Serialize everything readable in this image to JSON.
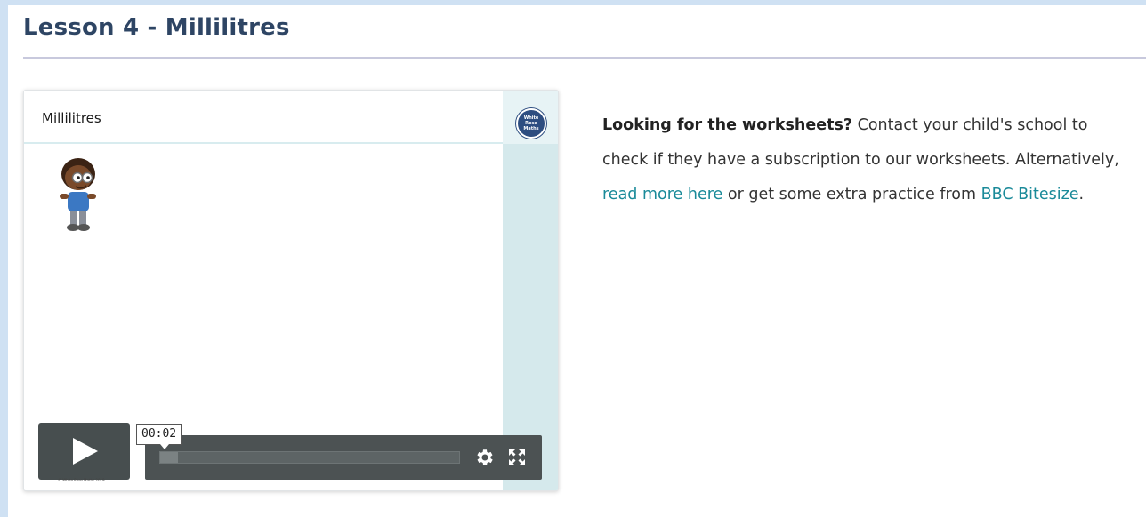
{
  "page": {
    "title": "Lesson 4 - Millilitres"
  },
  "video": {
    "title": "Millilitres",
    "logo_text": "White Rose Maths",
    "copyright": "© White Rose Maths 2019",
    "current_time": "00:02",
    "progress_fraction": 0.06,
    "icons": {
      "play": "play-icon",
      "settings": "gear-icon",
      "fullscreen": "fullscreen-icon",
      "logo": "white-rose-maths-logo-icon"
    }
  },
  "info": {
    "bold_lead": "Looking for the worksheets?",
    "text_1": " Contact your child's school to check if they have a subscription to our worksheets. Alternatively, ",
    "link_1": "read more here",
    "text_2": " or get some extra practice from ",
    "link_2": "BBC Bitesize",
    "text_3": "."
  },
  "colors": {
    "page_background": "#cfe1f3",
    "title": "#2e4564",
    "link": "#1a8a99",
    "player_controls": "#4c5253",
    "side_strip": "#d5e9ec"
  }
}
